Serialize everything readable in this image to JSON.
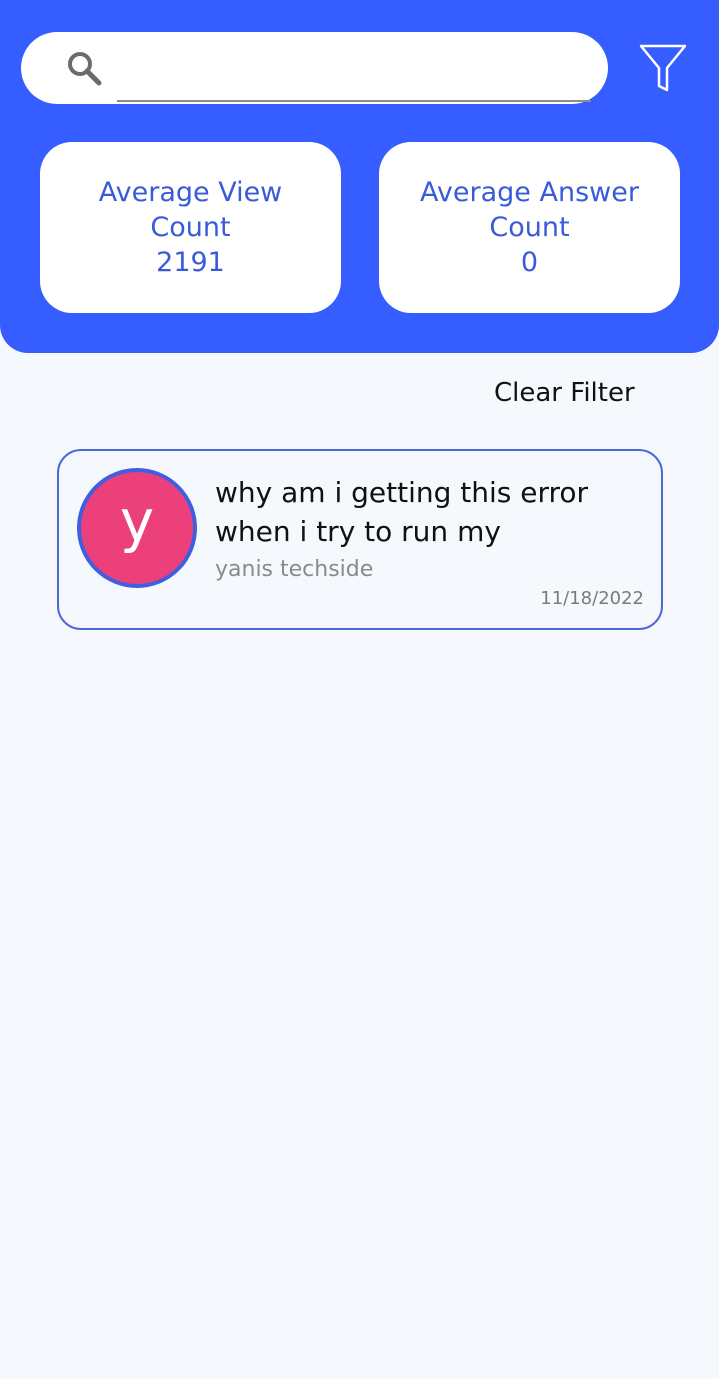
{
  "search": {
    "placeholder": "",
    "value": ""
  },
  "colors": {
    "header": "#365dff",
    "accent_text": "#3a5bd9",
    "avatar": "#ec407a",
    "avatar_border": "#3f5fe0"
  },
  "icons": {
    "search": "search-icon",
    "filter": "filter-icon"
  },
  "stats": {
    "views": {
      "label": "Average View Count",
      "value": "2191"
    },
    "answers": {
      "label": "Average Answer Count",
      "value": "0"
    }
  },
  "clear_filter_label": "Clear Filter",
  "questions": [
    {
      "avatar_letter": "y",
      "title": "why am i getting this error when i try to run my",
      "author": "yanis techside",
      "date": "11/18/2022"
    }
  ]
}
